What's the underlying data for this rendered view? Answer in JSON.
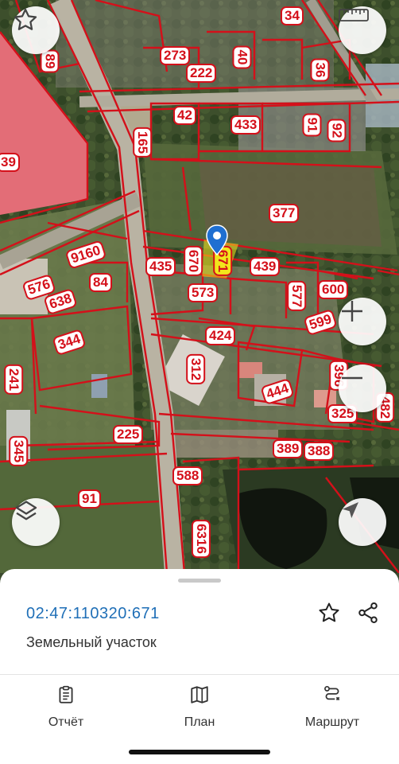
{
  "map": {
    "plot_labels": [
      "34",
      "89",
      "273",
      "40",
      "222",
      "36",
      "42",
      "433",
      "91",
      "92",
      "165",
      "39",
      "377",
      "9160",
      "670",
      "435",
      "439",
      "576",
      "84",
      "573",
      "577",
      "600",
      "638",
      "344",
      "424",
      "599",
      "312",
      "396",
      "241",
      "444",
      "325",
      "482",
      "225",
      "345",
      "389",
      "388",
      "588",
      "91",
      "6316"
    ],
    "selected_plot_label": "671",
    "marker": "location-pin-icon",
    "controls": {
      "favorite": "star-icon",
      "ruler": "ruler-icon",
      "zoom_in": "plus-icon",
      "zoom_out": "minus-icon",
      "layers": "layers-icon",
      "locate": "navigation-arrow-icon"
    }
  },
  "sheet": {
    "cadastral_number": "02:47:110320:671",
    "object_type": "Земельный участок",
    "favorite_icon": "star-outline-icon",
    "share_icon": "share-icon"
  },
  "nav": {
    "items": [
      {
        "label": "Отчёт",
        "icon": "clipboard-icon"
      },
      {
        "label": "План",
        "icon": "map-icon"
      },
      {
        "label": "Маршрут",
        "icon": "route-icon"
      }
    ]
  },
  "colors": {
    "boundary": "#d4101a",
    "link": "#1f6fb7",
    "selected_fill": "#f2e51c"
  }
}
